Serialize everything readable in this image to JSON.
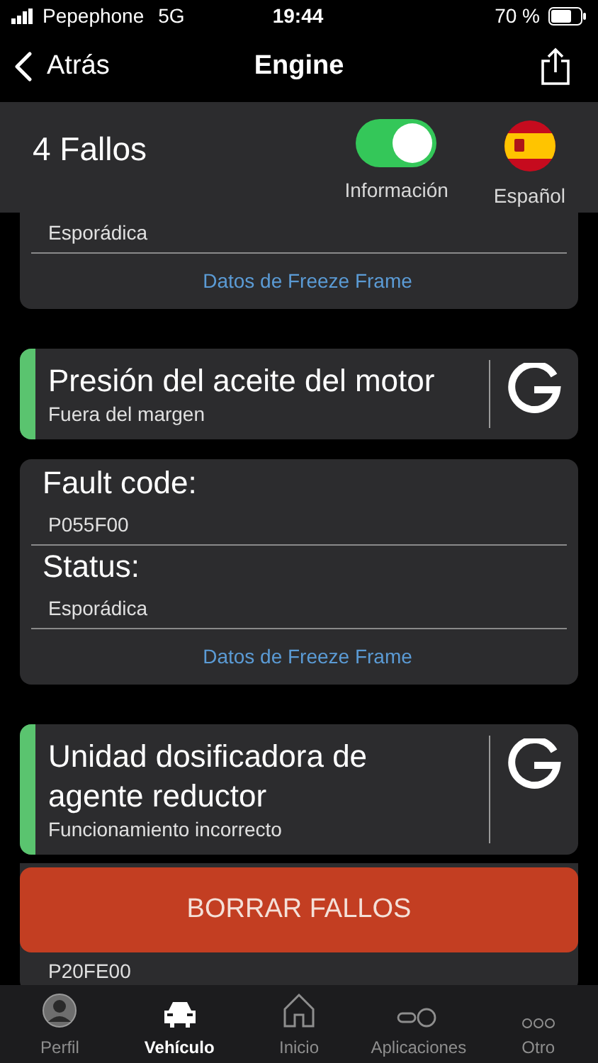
{
  "status_bar": {
    "carrier": "Pepephone",
    "network": "5G",
    "time": "19:44",
    "battery": "70 %"
  },
  "nav": {
    "back": "Atrás",
    "title": "Engine"
  },
  "summary": {
    "count": "4 Fallos",
    "toggle": {
      "label": "Información",
      "on": true
    },
    "language": {
      "label": "Español"
    }
  },
  "cards": [
    {
      "kind": "partial_detail",
      "rows": [
        {
          "value": "Esporádica"
        }
      ],
      "link": "Datos de Freeze Frame"
    },
    {
      "kind": "fault",
      "title": "Presión del aceite del motor",
      "subtitle": "Fuera del margen",
      "color": "#5ac46f"
    },
    {
      "kind": "detail",
      "rows": [
        {
          "label": "Fault code:",
          "value": "P055F00"
        },
        {
          "label": "Status:",
          "value": "Esporádica"
        }
      ],
      "link": "Datos de Freeze Frame"
    },
    {
      "kind": "fault",
      "title": "Unidad dosificadora de agente reductor",
      "subtitle": "Funcionamiento incorrecto",
      "color": "#5ac46f"
    },
    {
      "kind": "partial_detail",
      "rows": [
        {
          "value": "P20FE00"
        }
      ]
    }
  ],
  "clear_button": "BORRAR FALLOS",
  "tabs": [
    {
      "label": "Perfil",
      "selected": false
    },
    {
      "label": "Vehículo",
      "selected": true
    },
    {
      "label": "Inicio",
      "selected": false
    },
    {
      "label": "Aplicaciones",
      "selected": false
    },
    {
      "label": "Otro",
      "selected": false
    }
  ]
}
